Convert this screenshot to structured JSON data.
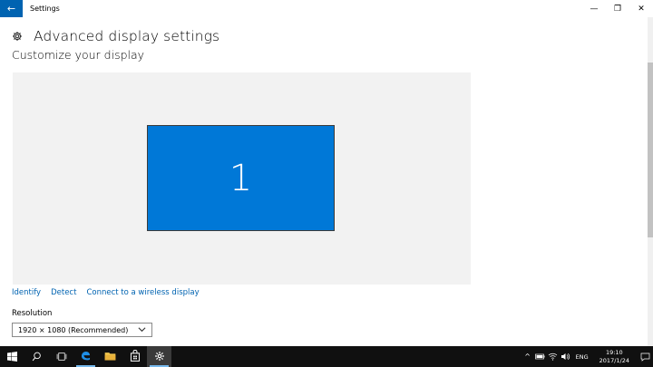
{
  "window": {
    "title": "Settings",
    "back_glyph": "←",
    "minimize_glyph": "—",
    "restore_glyph": "❐",
    "close_glyph": "✕"
  },
  "header": {
    "title": "Advanced display settings",
    "section": "Customize your display"
  },
  "preview": {
    "monitor_label": "1",
    "accent": "#0078d7",
    "background": "#f2f2f2"
  },
  "links": {
    "identify": "Identify",
    "detect": "Detect",
    "connect": "Connect to a wireless display"
  },
  "resolution": {
    "label": "Resolution",
    "selected": "1920 × 1080 (Recommended)"
  },
  "taskbar": {
    "icons": [
      "windows-logo-icon",
      "search-icon",
      "task-view-icon",
      "edge-icon",
      "file-explorer-icon",
      "store-icon",
      "settings-icon"
    ],
    "tray": {
      "chevron": "^",
      "language": "ENG",
      "time": "19:10",
      "date": "2017/1/24"
    }
  },
  "colors": {
    "brand_blue": "#0063b1",
    "taskbar": "#101010"
  }
}
